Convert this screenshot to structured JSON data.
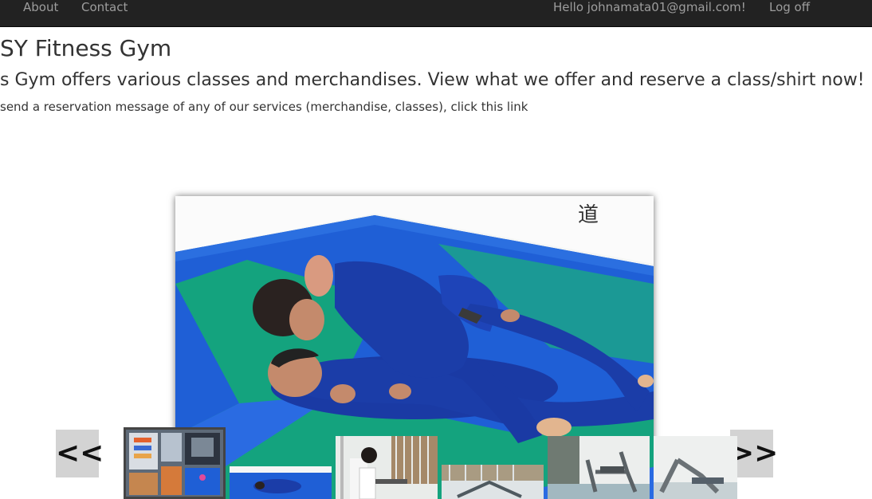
{
  "navbar": {
    "about": "About",
    "contact": "Contact",
    "greeting": "Hello johnamata01@gmail.com!",
    "logoff": "Log off"
  },
  "page": {
    "title": "SY Fitness Gym",
    "lead": "s Gym offers various classes and merchandises. View what we offer and reserve a class/shirt now!",
    "text": "send a reservation message of any of our services (merchandise, classes), click this link"
  },
  "carousel": {
    "prev_label": "<<",
    "next_label": ">>"
  },
  "colors": {
    "navbar": "#222222",
    "nav_text": "#9d9d9d",
    "mat_blue": "#1f5fd6",
    "mat_green": "#14a37e",
    "gi_blue": "#1b3da8"
  }
}
